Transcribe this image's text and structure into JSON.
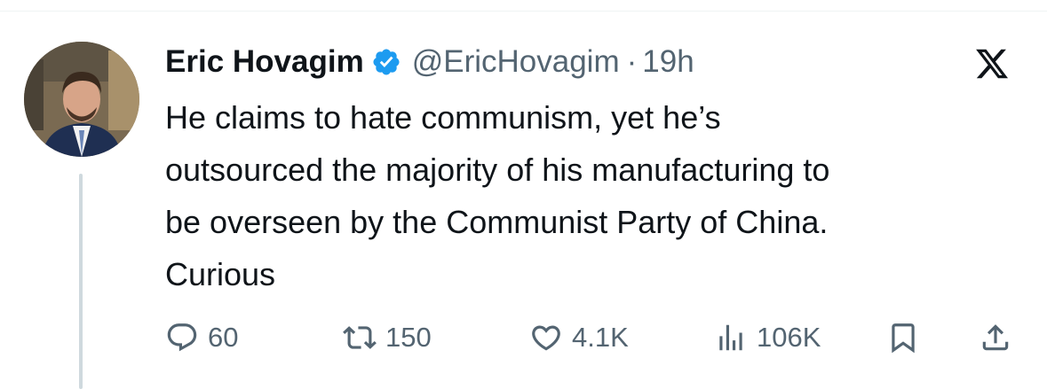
{
  "author": {
    "display_name": "Eric Hovagim",
    "handle": "@EricHovagim",
    "separator": "·",
    "time": "19h",
    "verified": true
  },
  "tweet": {
    "lines": [
      "He claims to hate communism, yet he’s",
      "outsourced the majority of his manufacturing to",
      "be overseen by the Communist Party of China.",
      "Curious"
    ]
  },
  "actions": {
    "replies": "60",
    "reposts": "150",
    "likes": "4.1K",
    "views": "106K"
  },
  "icons": {
    "brand": "x-logo-icon",
    "verified": "verified-badge-icon",
    "reply": "reply-icon",
    "repost": "repost-icon",
    "like": "heart-icon",
    "views": "views-icon",
    "bookmark": "bookmark-icon",
    "share": "share-icon"
  },
  "colors": {
    "text": "#0f1419",
    "secondary": "#536471",
    "verified": "#1d9bf0",
    "thread_line": "#cfd9de"
  }
}
